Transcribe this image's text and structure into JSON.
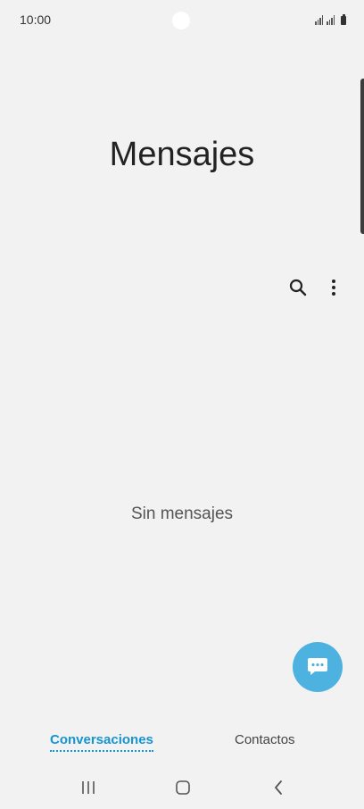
{
  "status_bar": {
    "time": "10:00",
    "icons": [
      "signal-icon",
      "signal-icon",
      "battery-icon"
    ]
  },
  "header": {
    "title": "Mensajes"
  },
  "toolbar": {
    "icons": [
      "search-icon",
      "more-options-icon"
    ]
  },
  "main": {
    "empty_state": "Sin mensajes"
  },
  "fab": {
    "icon": "new-message-icon",
    "color": "#4db2e0"
  },
  "tabs": [
    {
      "label": "Conversaciones",
      "active": true
    },
    {
      "label": "Contactos",
      "active": false
    }
  ],
  "nav_bar": {
    "icons": [
      "recent-apps-icon",
      "home-icon",
      "back-icon"
    ]
  },
  "colors": {
    "accent": "#1595cf",
    "background": "#f2f2f2"
  }
}
